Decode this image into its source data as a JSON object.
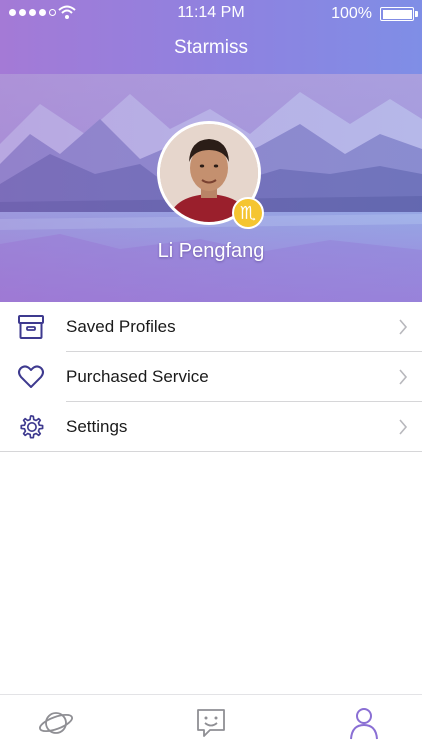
{
  "status_bar": {
    "time": "11:14 PM",
    "battery": "100%"
  },
  "nav": {
    "title": "Starmiss"
  },
  "profile": {
    "name": "Li Pengfang",
    "zodiac_symbol": "♏"
  },
  "menu": [
    {
      "label": "Saved Profiles",
      "icon": "archive-box-icon"
    },
    {
      "label": "Purchased Service",
      "icon": "heart-icon"
    },
    {
      "label": "Settings",
      "icon": "gear-icon"
    }
  ],
  "tabs": [
    {
      "icon": "planet-icon",
      "active": false
    },
    {
      "icon": "chat-bubble-icon",
      "active": false
    },
    {
      "icon": "person-icon",
      "active": true
    }
  ],
  "colors": {
    "accent": "#8a6fd4",
    "icon_inactive": "#8f8f94",
    "badge": "#f5c531"
  }
}
